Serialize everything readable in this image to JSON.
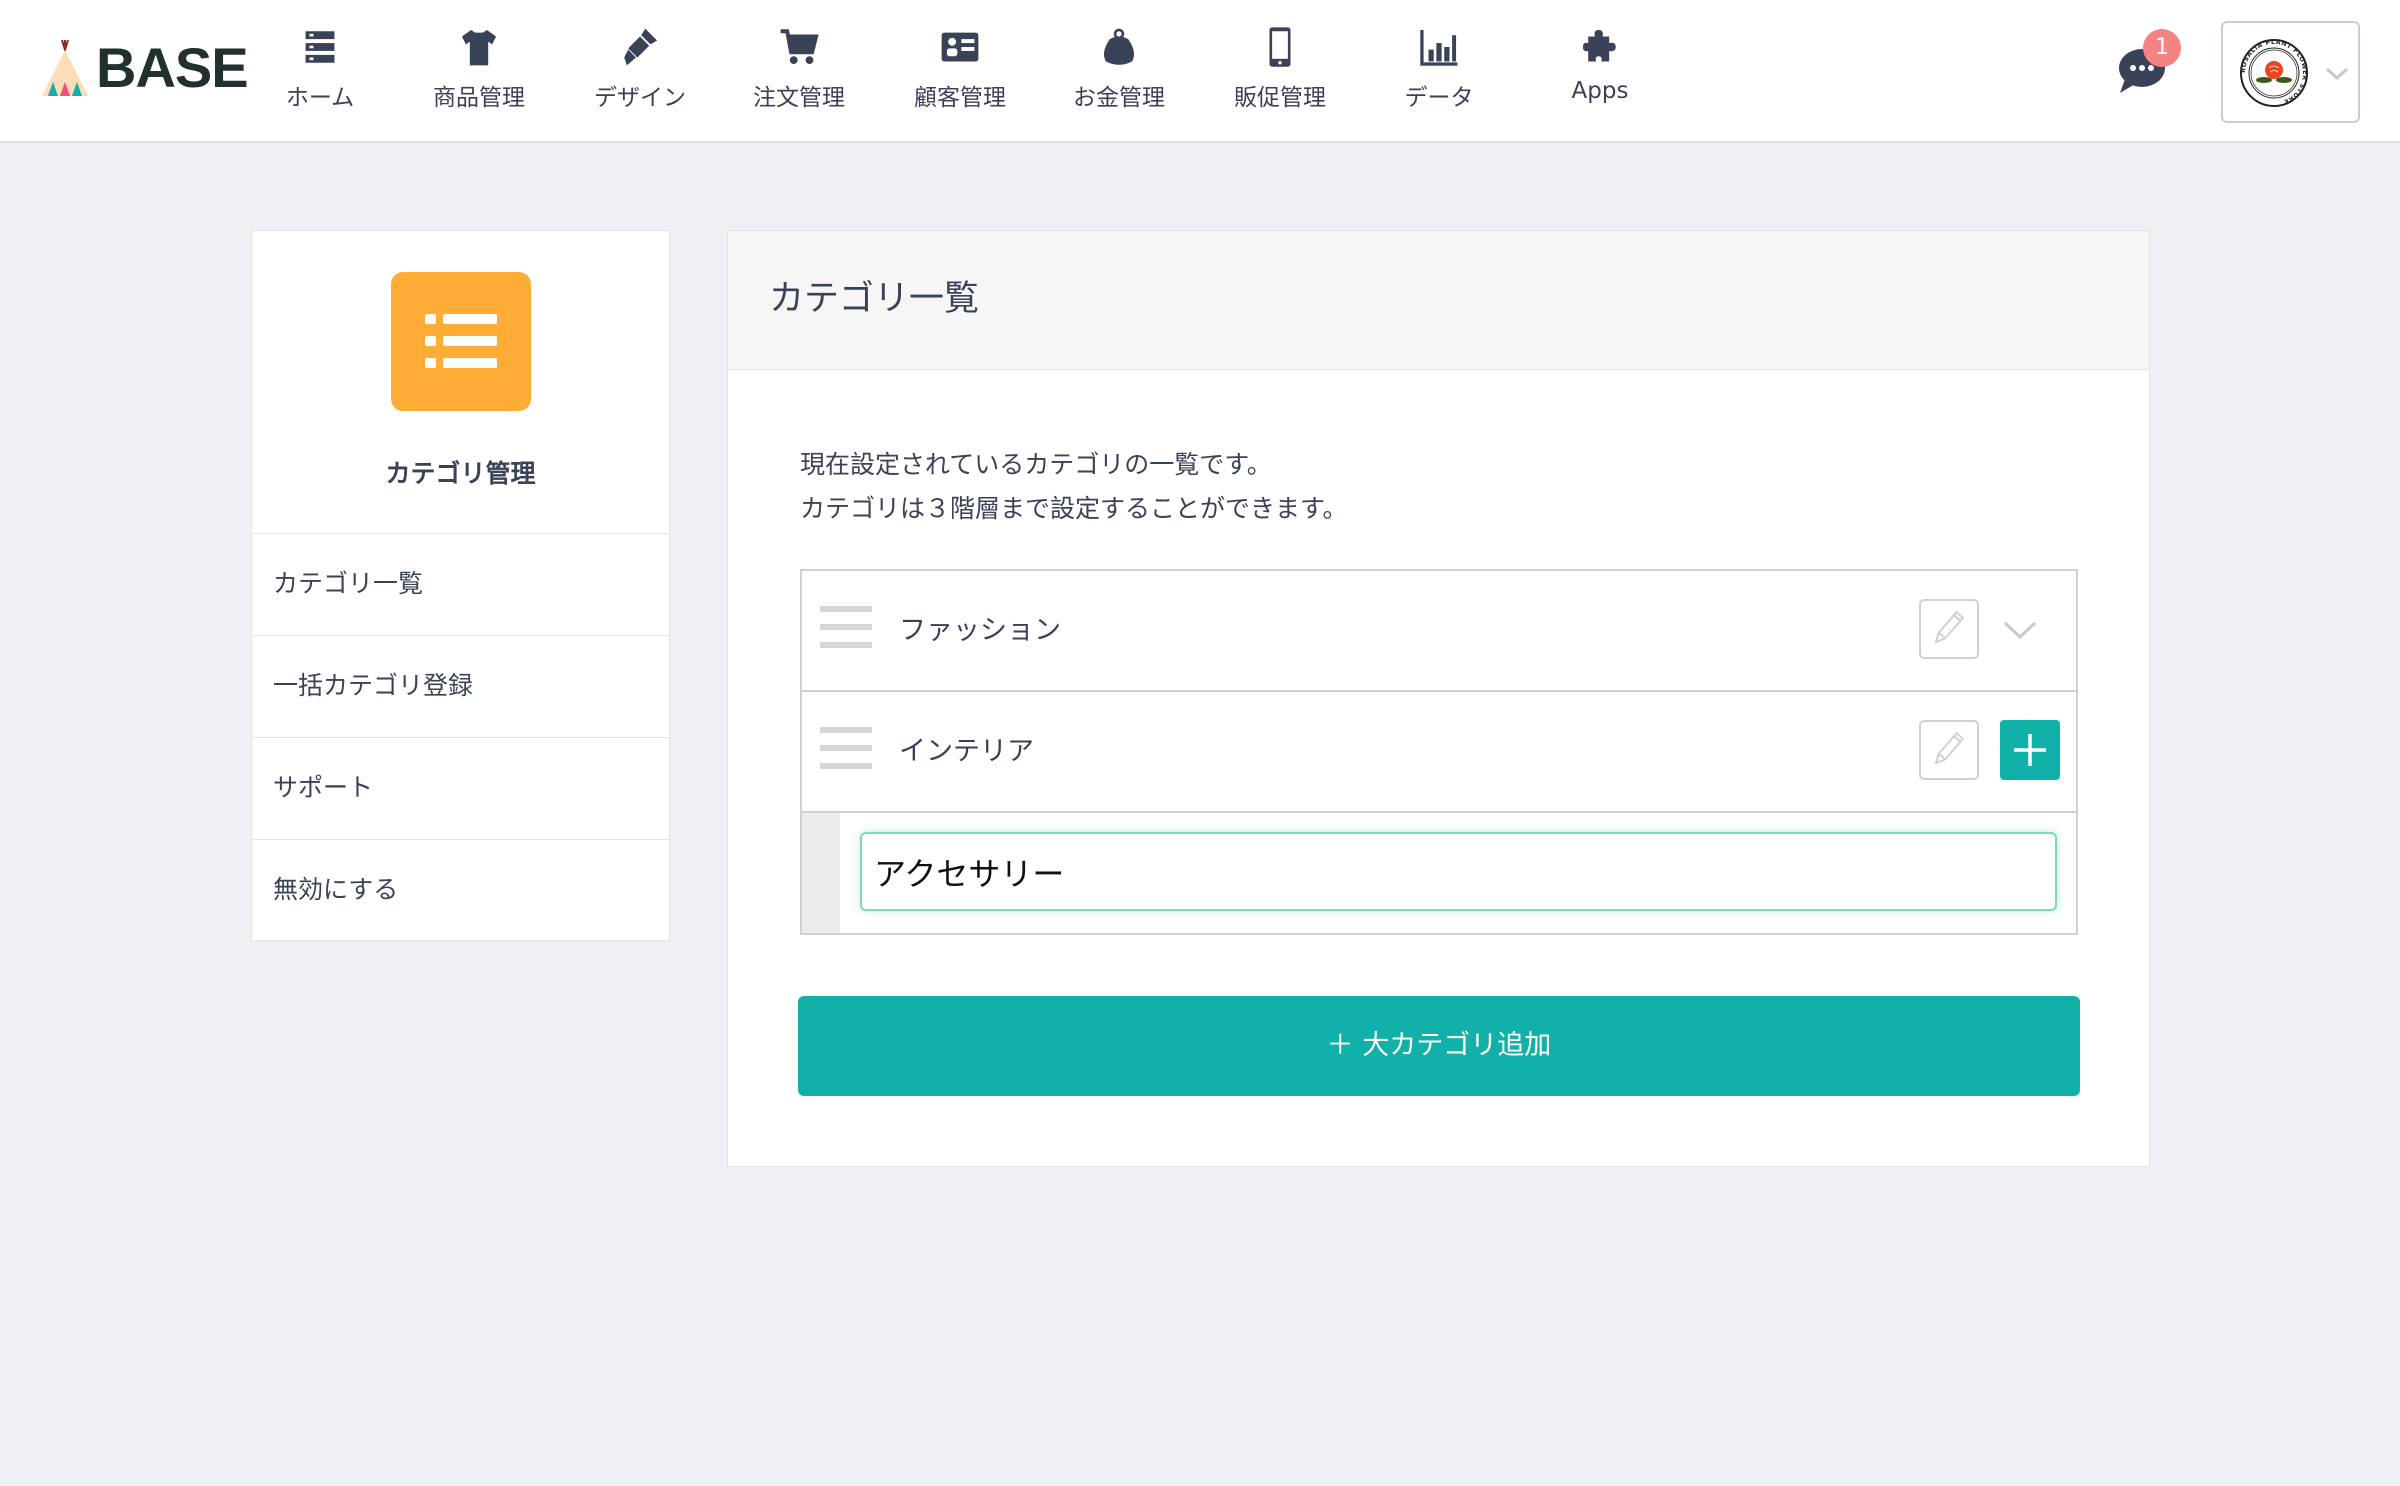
{
  "header": {
    "logo_text": "BASE",
    "nav": [
      {
        "label": "ホーム",
        "icon": "home-list-icon"
      },
      {
        "label": "商品管理",
        "icon": "tshirt-icon"
      },
      {
        "label": "デザイン",
        "icon": "brush-icon"
      },
      {
        "label": "注文管理",
        "icon": "cart-icon"
      },
      {
        "label": "顧客管理",
        "icon": "id-card-icon"
      },
      {
        "label": "お金管理",
        "icon": "purse-icon"
      },
      {
        "label": "販促管理",
        "icon": "smartphone-icon"
      },
      {
        "label": "データ",
        "icon": "bar-chart-icon"
      },
      {
        "label": "Apps",
        "icon": "puzzle-icon"
      }
    ],
    "notification_count": "1",
    "account_logo_text": "ROSALIA PLANT FLOWER STORE"
  },
  "sidebar": {
    "title": "カテゴリ管理",
    "icon": "list-icon",
    "icon_color": "#ffad37",
    "items": [
      {
        "label": "カテゴリ一覧"
      },
      {
        "label": "一括カテゴリ登録"
      },
      {
        "label": "サポート"
      },
      {
        "label": "無効にする"
      }
    ]
  },
  "main": {
    "title": "カテゴリ一覧",
    "description": [
      "現在設定されているカテゴリの一覧です。",
      "カテゴリは３階層まで設定することができます。"
    ],
    "categories": [
      {
        "label": "ファッション"
      },
      {
        "label": "インテリア"
      }
    ],
    "sub_input_value": "アクセサリー",
    "add_button_label": "＋ 大カテゴリ追加",
    "accent_color": "#11b0a8"
  }
}
